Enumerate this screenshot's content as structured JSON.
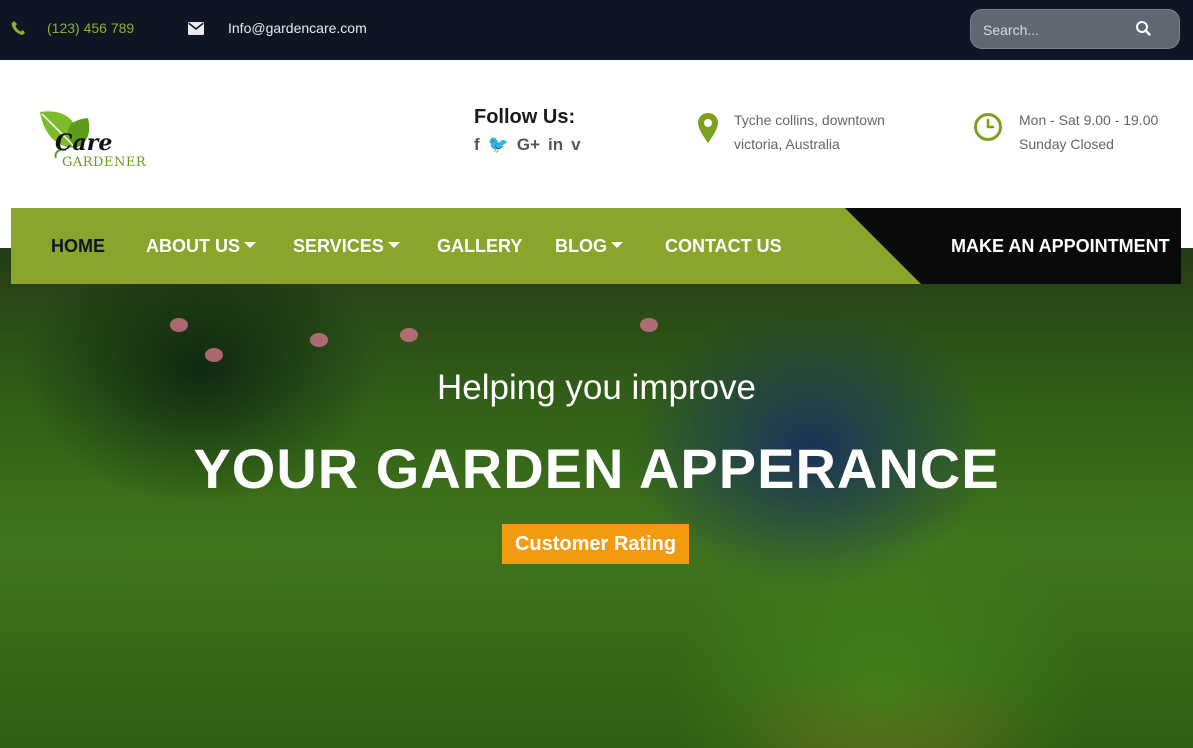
{
  "topbar": {
    "phone": "(123) 456 789",
    "email": "Info@gardencare.com",
    "search_placeholder": "Search..."
  },
  "brand": {
    "name_top": "Care",
    "name_bottom": "GARDENER"
  },
  "follow": {
    "title": "Follow Us:",
    "icons": [
      "facebook-icon",
      "twitter-icon",
      "google-plus-icon",
      "linkedin-icon",
      "vimeo-icon"
    ]
  },
  "location": {
    "line1": "Tyche collins, downtown",
    "line2": "victoria, Australia"
  },
  "hours": {
    "line1": "Mon - Sat 9.00 - 19.00",
    "line2": "Sunday Closed"
  },
  "nav": {
    "items": [
      {
        "label": "HOME",
        "active": true
      },
      {
        "label": "ABOUT US",
        "dropdown": true
      },
      {
        "label": "SERVICES",
        "dropdown": true
      },
      {
        "label": "GALLERY"
      },
      {
        "label": "BLOG",
        "dropdown": true
      },
      {
        "label": "CONTACT US"
      }
    ],
    "cta": "MAKE AN APPOINTMENT"
  },
  "hero": {
    "subtitle": "Helping you improve",
    "title": "YOUR GARDEN APPERANCE",
    "button": "Customer Rating"
  },
  "colors": {
    "accent_green": "#8aa52c",
    "topbar_bg": "#0e1623",
    "button_orange": "#f29b10"
  }
}
